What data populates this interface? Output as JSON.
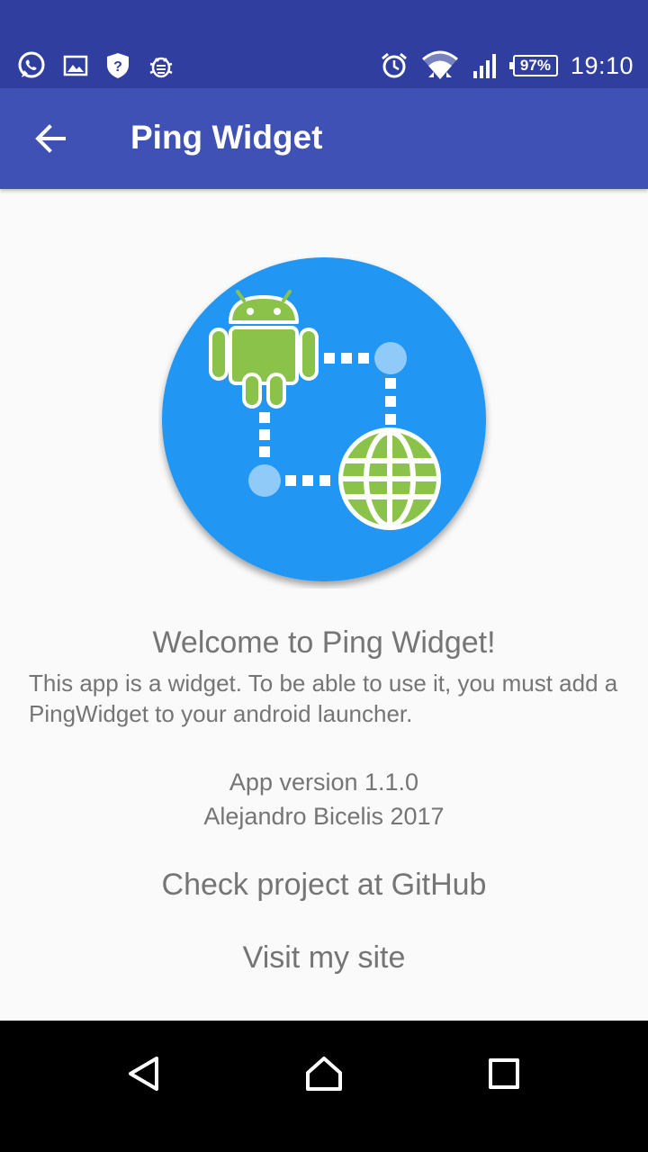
{
  "status_bar": {
    "left_icons": [
      "whatsapp-icon",
      "gallery-icon",
      "shield-icon",
      "bug-icon"
    ],
    "right_icons": [
      "alarm-icon",
      "wifi-icon",
      "signal-icon"
    ],
    "battery": "97%",
    "time": "19:10"
  },
  "app_bar": {
    "title": "Ping Widget",
    "back_icon": "arrow-back-icon"
  },
  "logo": {
    "icon": "ping-widget-logo-icon",
    "colors": {
      "circle": "#2196f3",
      "android": "#8bc34a",
      "dots": "#90caf9"
    }
  },
  "content": {
    "welcome": "Welcome to Ping Widget!",
    "description": "This app is a widget. To be able to use it, you must add a PingWidget to your android launcher.",
    "version": "App version 1.1.0",
    "author": "Alejandro Bicelis 2017",
    "github_link": "Check project at GitHub",
    "site_link": "Visit my site"
  },
  "nav_bar": {
    "buttons": [
      "back-triangle-icon",
      "home-icon",
      "recents-icon"
    ]
  },
  "colors": {
    "status_bar": "#303f9f",
    "app_bar": "#3f51b5",
    "background": "#fafafa",
    "text": "#757575"
  }
}
